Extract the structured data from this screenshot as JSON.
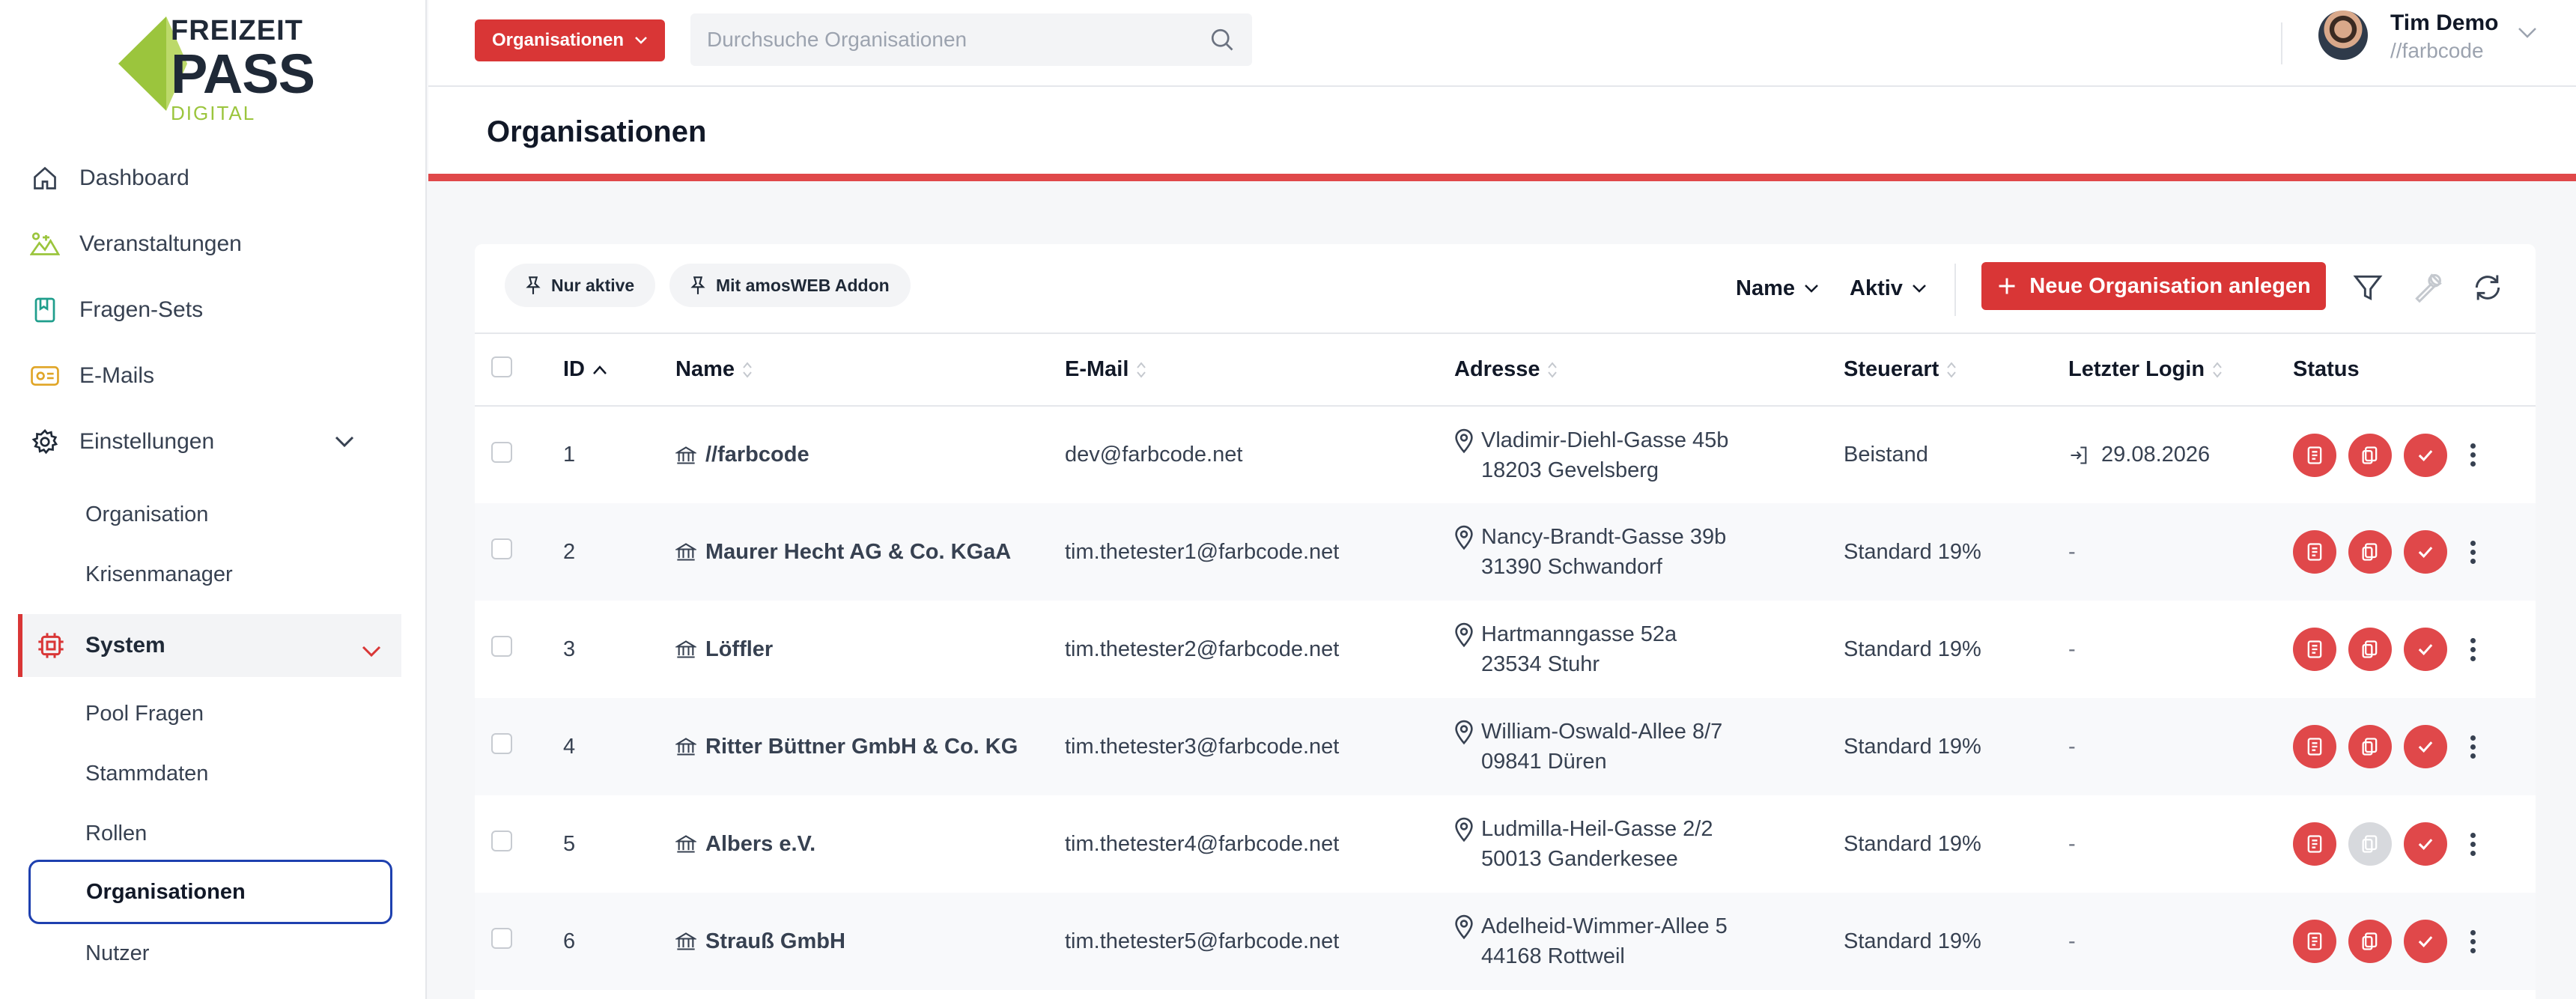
{
  "logo": {
    "line1": "FREIZEIT",
    "line2": "PASS",
    "line3": "DIGITAL",
    "accent": "#9bc53d"
  },
  "sidebar": {
    "items": [
      {
        "label": "Dashboard",
        "icon": "home-icon"
      },
      {
        "label": "Veranstaltungen",
        "icon": "events-icon"
      },
      {
        "label": "Fragen-Sets",
        "icon": "book-icon"
      },
      {
        "label": "E-Mails",
        "icon": "mail-icon"
      },
      {
        "label": "Einstellungen",
        "icon": "gear-icon"
      }
    ],
    "einstellungen_sub": [
      "Organisation",
      "Krisenmanager"
    ],
    "system_label": "System",
    "system_sub": [
      "Pool Fragen",
      "Stammdaten",
      "Rollen",
      "Organisationen",
      "Nutzer"
    ]
  },
  "topbar": {
    "context_button": "Organisationen",
    "search_placeholder": "Durchsuche Organisationen",
    "user_name": "Tim Demo",
    "user_org": "//farbcode"
  },
  "page": {
    "title": "Organisationen"
  },
  "toolbar": {
    "chip_active": "Nur aktive",
    "chip_addon": "Mit amosWEB Addon",
    "sort_name": "Name",
    "sort_active": "Aktiv",
    "new_button": "Neue Organisation anlegen"
  },
  "table": {
    "headers": {
      "id": "ID",
      "name": "Name",
      "email": "E-Mail",
      "address": "Adresse",
      "tax": "Steuerart",
      "login": "Letzter Login",
      "status": "Status"
    },
    "rows": [
      {
        "id": "1",
        "name": "//farbcode",
        "email": "dev@farbcode.net",
        "street": "Vladimir-Diehl-Gasse 45b",
        "city": "18203 Gevelsberg",
        "tax": "Beistand",
        "login": "29.08.2026",
        "has_login": true,
        "second_status_on": true
      },
      {
        "id": "2",
        "name": "Maurer Hecht AG & Co. KGaA",
        "email": "tim.thetester1@farbcode.net",
        "street": "Nancy-Brandt-Gasse 39b",
        "city": "31390 Schwandorf",
        "tax": "Standard 19%",
        "login": "-",
        "has_login": false,
        "second_status_on": true
      },
      {
        "id": "3",
        "name": "Löffler",
        "email": "tim.thetester2@farbcode.net",
        "street": "Hartmanngasse 52a",
        "city": "23534 Stuhr",
        "tax": "Standard 19%",
        "login": "-",
        "has_login": false,
        "second_status_on": true
      },
      {
        "id": "4",
        "name": "Ritter Büttner GmbH & Co. KG",
        "email": "tim.thetester3@farbcode.net",
        "street": "William-Oswald-Allee 8/7",
        "city": "09841 Düren",
        "tax": "Standard 19%",
        "login": "-",
        "has_login": false,
        "second_status_on": true
      },
      {
        "id": "5",
        "name": "Albers e.V.",
        "email": "tim.thetester4@farbcode.net",
        "street": "Ludmilla-Heil-Gasse 2/2",
        "city": "50013 Ganderkesee",
        "tax": "Standard 19%",
        "login": "-",
        "has_login": false,
        "second_status_on": false
      },
      {
        "id": "6",
        "name": "Strauß GmbH",
        "email": "tim.thetester5@farbcode.net",
        "street": "Adelheid-Wimmer-Allee 5",
        "city": "44168 Rottweil",
        "tax": "Standard 19%",
        "login": "-",
        "has_login": false,
        "second_status_on": true
      }
    ]
  },
  "colors": {
    "primary": "#d93636",
    "active_border": "#1e40af",
    "disabled": "#d7d9dd"
  }
}
